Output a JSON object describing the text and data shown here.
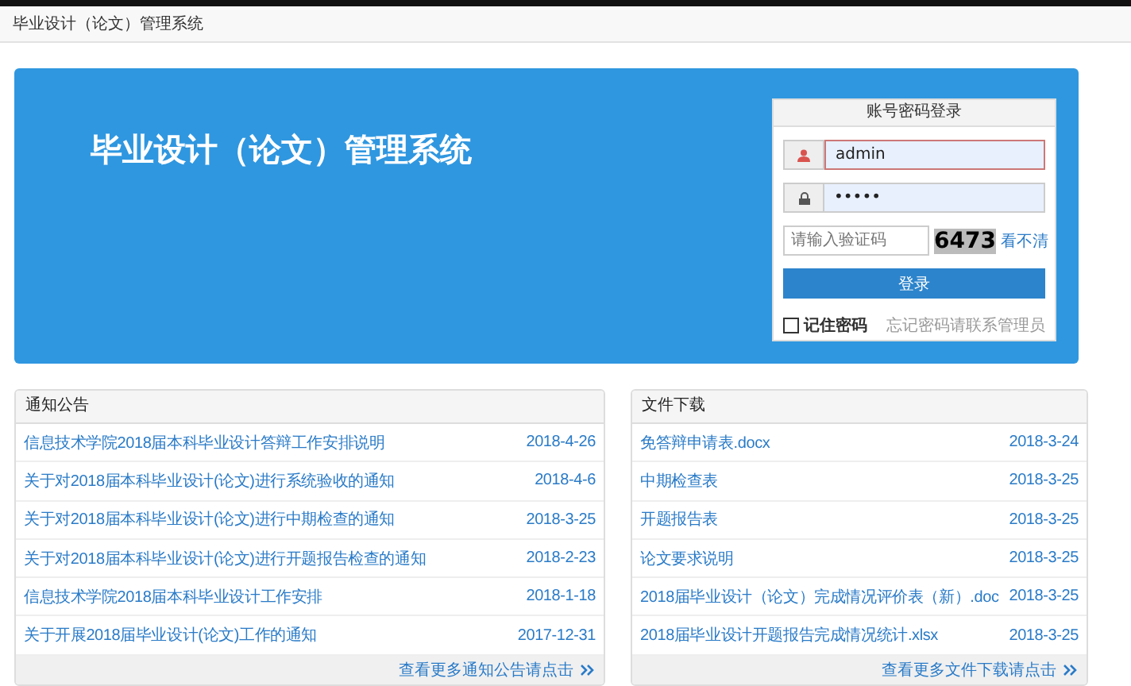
{
  "header": {
    "title": "毕业设计（论文）管理系统"
  },
  "banner": {
    "title": "毕业设计（论文）管理系统"
  },
  "login": {
    "title": "账号密码登录",
    "username": "admin",
    "password": "•••••",
    "captcha_placeholder": "请输入验证码",
    "captcha": "6473",
    "refresh": "看不清",
    "submit": "登录",
    "remember": {
      "label": "记住密码",
      "checked": false
    },
    "forgot": "忘记密码请联系管理员"
  },
  "panels": [
    {
      "title": "通知公告",
      "rows": [
        {
          "text": "信息技术学院2018届本科毕业设计答辩工作安排说明",
          "date": "2018-4-26"
        },
        {
          "text": "关于对2018届本科毕业设计(论文)进行系统验收的通知",
          "date": "2018-4-6"
        },
        {
          "text": "关于对2018届本科毕业设计(论文)进行中期检查的通知",
          "date": "2018-3-25"
        },
        {
          "text": "关于对2018届本科毕业设计(论文)进行开题报告检查的通知",
          "date": "2018-2-23"
        },
        {
          "text": "信息技术学院2018届本科毕业设计工作安排",
          "date": "2018-1-18"
        },
        {
          "text": "关于开展2018届毕业设计(论文)工作的通知",
          "date": "2017-12-31"
        }
      ],
      "more": "查看更多通知公告请点击"
    },
    {
      "title": "文件下载",
      "rows": [
        {
          "text": "免答辩申请表.docx",
          "date": "2018-3-24"
        },
        {
          "text": "中期检查表",
          "date": "2018-3-25"
        },
        {
          "text": "开题报告表",
          "date": "2018-3-25"
        },
        {
          "text": "论文要求说明",
          "date": "2018-3-25"
        },
        {
          "text": "2018届毕业设计（论文）完成情况评价表（新）.doc",
          "date": "2018-3-25"
        },
        {
          "text": "2018届毕业设计开题报告完成情况统计.xlsx",
          "date": "2018-3-25"
        }
      ],
      "more": "查看更多文件下载请点击"
    }
  ]
}
